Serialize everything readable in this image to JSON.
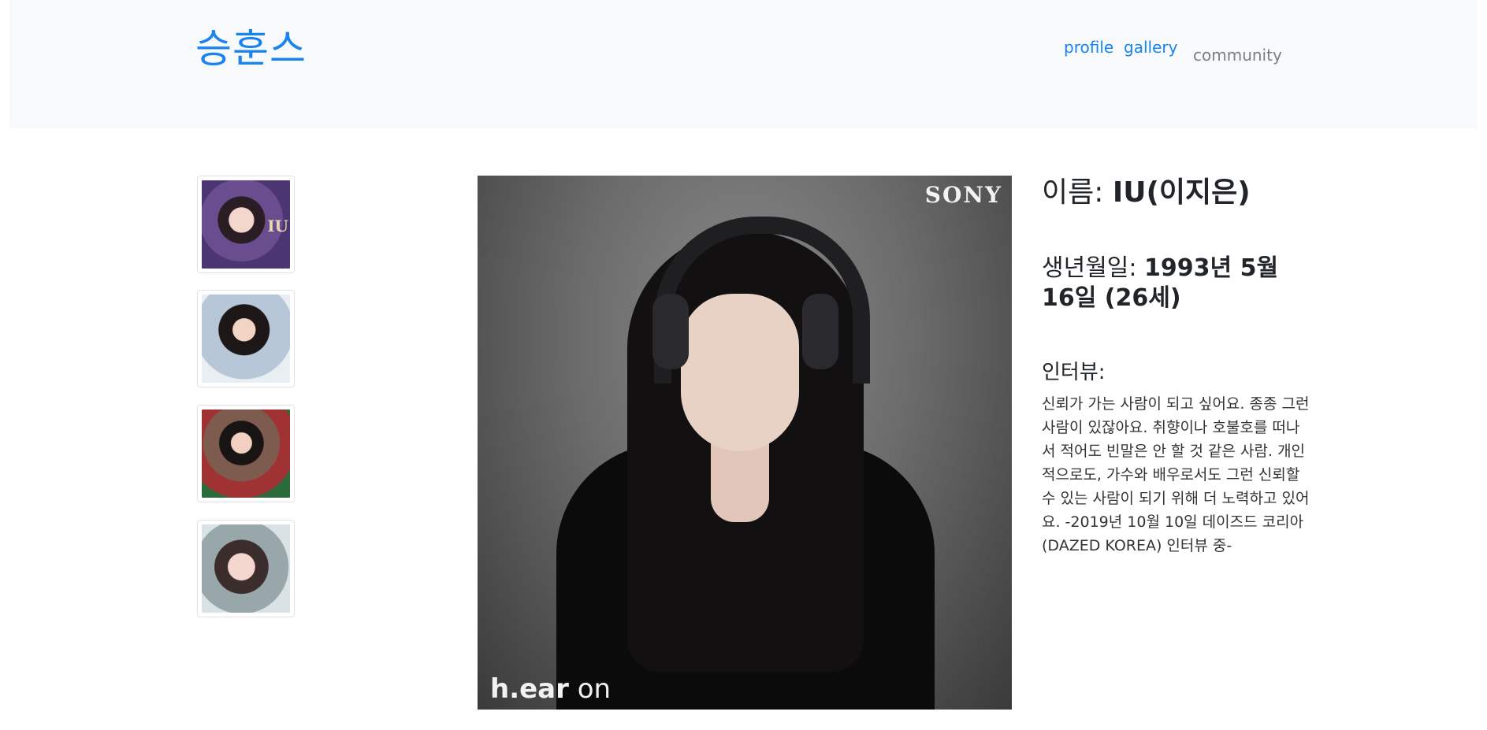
{
  "navbar": {
    "brand": "승훈스",
    "links": [
      "profile",
      "gallery",
      "community"
    ]
  },
  "thumbnails": [
    "thumb-1",
    "thumb-2",
    "thumb-3",
    "thumb-4"
  ],
  "thumb_overlay": "IU",
  "photo": {
    "brand_text": "SONY",
    "tagline_bold": "h.ear",
    "tagline_rest": " on"
  },
  "profile": {
    "name_label": "이름: ",
    "name_value": "IU(이지은)",
    "birth_label": "생년월일: ",
    "birth_value": "1993년 5월 16일 (26세)",
    "interview_label": "인터뷰:",
    "interview_text": "신뢰가 가는 사람이 되고 싶어요. 종종 그런 사람이 있잖아요. 취향이나 호불호를 떠나서 적어도 빈말은 안 할 것 같은 사람. 개인적으로도, 가수와 배우로서도 그런 신뢰할 수 있는 사람이 되기 위해 더 노력하고 있어요. -2019년 10월 10일 데이즈드 코리아(DAZED KOREA) 인터뷰 중-"
  },
  "colors": {
    "brand": "#1a84ee",
    "nav_inactive": "#7c7f82",
    "navbar_bg": "#f8f9fa"
  }
}
